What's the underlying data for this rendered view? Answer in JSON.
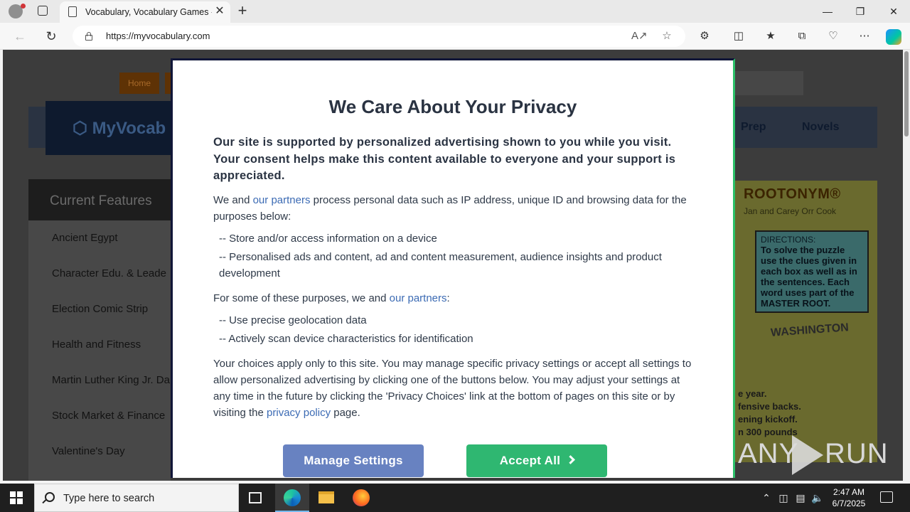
{
  "browser": {
    "tab_title": "Vocabulary, Vocabulary Games - …",
    "url": "https://myvocabulary.com",
    "new_tab_glyph": "+",
    "close_glyph": "✕"
  },
  "site": {
    "home_label": "Home",
    "logo_text": "MyVocab",
    "nav_items": [
      "Prep",
      "Novels"
    ],
    "features_heading": "Current Features",
    "features": [
      "Ancient Egypt",
      "Character Edu. & Leade",
      "Election Comic Strip",
      "Health and Fitness",
      "Martin Luther King Jr. Da",
      "Stock Market & Finance",
      "Valentine's Day"
    ],
    "puzzle": {
      "title": "ROOTONYM®",
      "byline": "Jan and Carey Orr Cook",
      "directions_head": "DIRECTIONS:",
      "directions_text": "To solve the puzzle use the clues given in each box as well as in the sentences. Each word uses part of the MASTER ROOT.",
      "word": "WASHINGTON",
      "fragments": [
        "e year.",
        "fensive backs.",
        "ening kickoff.",
        "n 300 pounds"
      ]
    }
  },
  "modal": {
    "title": "We Care About Your Privacy",
    "lead": "Our site is supported by personalized advertising shown to you while you visit. Your consent helps make this content available to everyone and your support is appreciated.",
    "p1_pre": "We and ",
    "p1_link": "our partners",
    "p1_post": " process personal data such as IP address, unique ID and browsing data for the purposes below:",
    "list1": [
      "-- Store and/or access information on a device",
      "-- Personalised ads and content, ad and content measurement, audience insights and product development"
    ],
    "p2_pre": "For some of these purposes, we and ",
    "p2_link": "our partners",
    "p2_post": ":",
    "list2": [
      "-- Use precise geolocation data",
      "-- Actively scan device characteristics for identification"
    ],
    "p3_pre": "Your choices apply only to this site. You may manage specific privacy settings or accept all settings to allow personalized advertising by clicking one of the buttons below. You may adjust your settings at any time in the future by clicking the 'Privacy Choices' link at the bottom of pages on this site or by visiting the ",
    "p3_link": "privacy policy",
    "p3_post": " page.",
    "manage_label": "Manage Settings",
    "accept_label": "Accept All"
  },
  "watermark": {
    "left": "ANY",
    "right": "RUN"
  },
  "taskbar": {
    "search_placeholder": "Type here to search",
    "time": "2:47 AM",
    "date": "6/7/2025"
  },
  "colors": {
    "accept": "#2fb771",
    "manage": "#6882c1",
    "link": "#3c6bb4",
    "modal_border": "#111638"
  }
}
